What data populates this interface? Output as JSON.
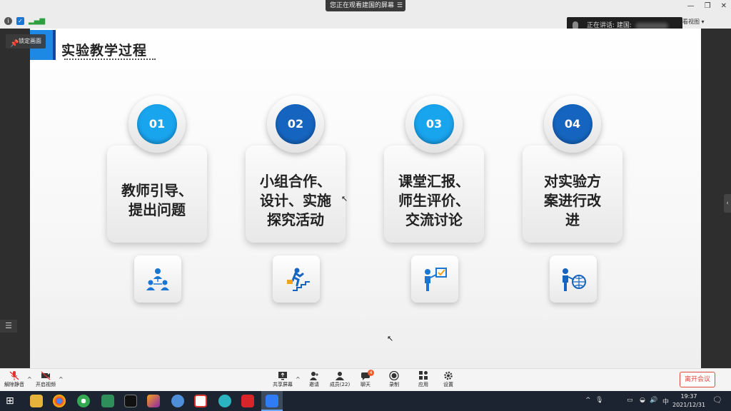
{
  "window": {
    "viewing_banner": "您正在观看建国的屏幕",
    "speaking_label": "正在讲话: 建国:",
    "view_label": "看视图",
    "pin_label": "锁定画面"
  },
  "slide": {
    "title": "实验教学过程",
    "steps": [
      {
        "number": "01",
        "text": "教师引导、\n提出问题",
        "color": "#19a4ee",
        "icon": "team-hierarchy-icon"
      },
      {
        "number": "02",
        "text": "小组合作、\n设计、实施\n探究活动",
        "color": "#1565c0",
        "icon": "running-stairs-icon"
      },
      {
        "number": "03",
        "text": "课堂汇报、\n师生评价、\n交流讨论",
        "color": "#19a4ee",
        "icon": "presenter-check-icon"
      },
      {
        "number": "04",
        "text": "对实验方\n案进行改\n进",
        "color": "#1565c0",
        "icon": "presenter-globe-icon"
      }
    ]
  },
  "toolbar": {
    "unmute": "解除静音",
    "start_video": "开启视频",
    "share_screen": "共享屏幕",
    "host_tools": "邀请",
    "participants": "成员(22)",
    "chat": "聊天",
    "chat_badge": "4",
    "record": "录制",
    "apps": "应用",
    "settings": "设置",
    "leave": "离开会议"
  },
  "taskbar": {
    "time": "19:37",
    "date": "2021/12/31",
    "ime": "中"
  },
  "colors": {
    "accent_blue": "#1e88e5",
    "dark_blue": "#1565c0",
    "light_blue": "#19a4ee",
    "leave_red": "#e04a3a"
  }
}
